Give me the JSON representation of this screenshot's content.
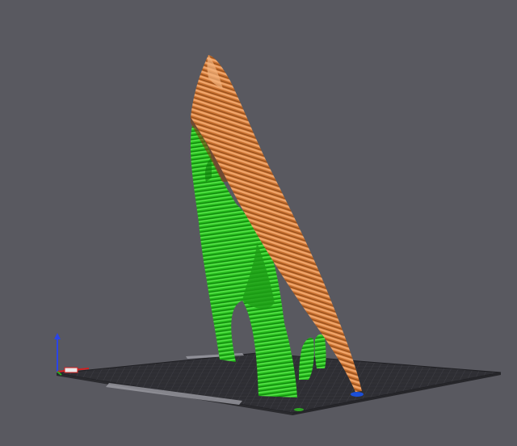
{
  "viewport": {
    "background_color": "#595960",
    "bed_color": "#2d2d31",
    "bed_grid_color": "#3b3b40",
    "axis_colors": {
      "x": "#d02020",
      "y": "#20b020",
      "z": "#2040e0"
    },
    "support_color": "#2ec21f",
    "model_color": "#d47a3c"
  }
}
